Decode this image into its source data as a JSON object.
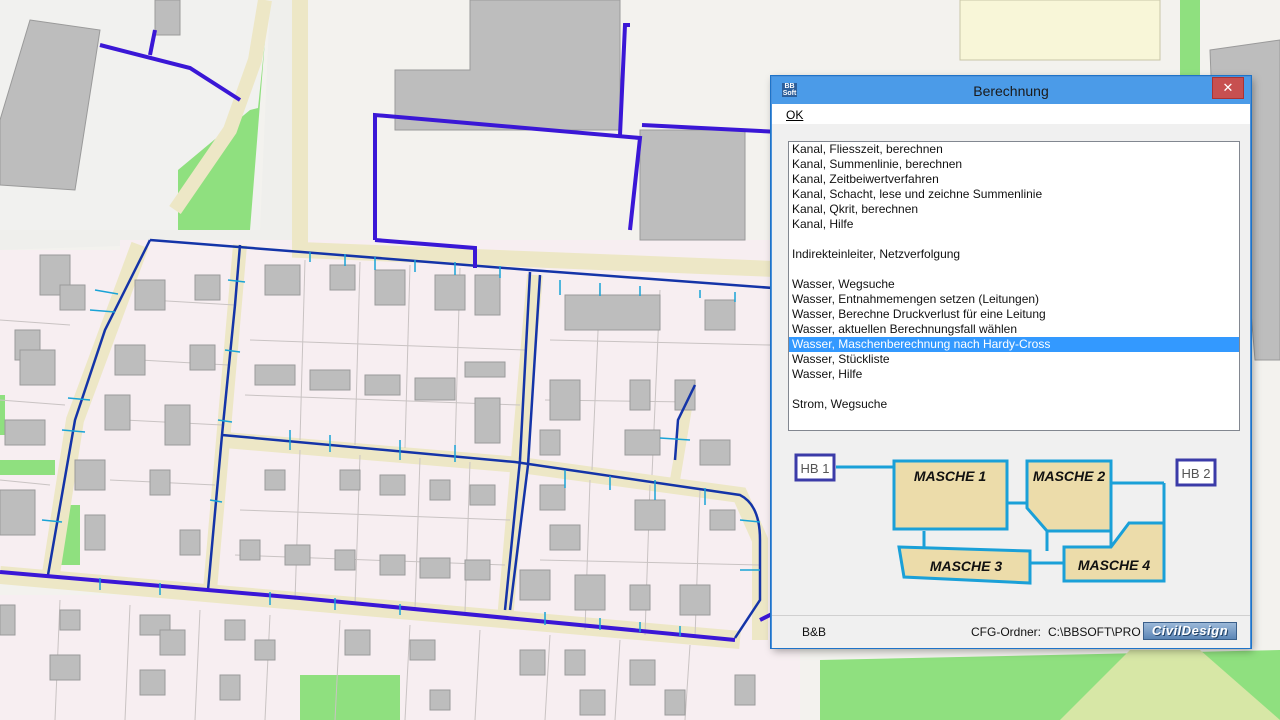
{
  "window": {
    "title": "Berechnung",
    "close_glyph": "✕",
    "app_icon_text": "BB Soft"
  },
  "menu": {
    "ok_label": "OK"
  },
  "list": {
    "items": [
      "Kanal, Fliesszeit, berechnen",
      "Kanal, Summenlinie, berechnen",
      "Kanal, Zeitbeiwertverfahren",
      "Kanal, Schacht, lese und zeichne Summenlinie",
      "Kanal, Qkrit, berechnen",
      "Kanal, Hilfe",
      "",
      "Indirekteinleiter, Netzverfolgung",
      "",
      "Wasser, Wegsuche",
      "Wasser, Entnahmemengen setzen (Leitungen)",
      "Wasser, Berechne Druckverlust für eine Leitung",
      "Wasser, aktuellen Berechnungsfall wählen",
      "Wasser, Maschenberechnung nach Hardy-Cross",
      "Wasser, Stückliste",
      "Wasser, Hilfe",
      "",
      "Strom, Wegsuche"
    ],
    "selected_index": 13
  },
  "diagram": {
    "hb1": "HB 1",
    "hb2": "HB 2",
    "masche1": "MASCHE 1",
    "masche2": "MASCHE 2",
    "masche3": "MASCHE 3",
    "masche4": "MASCHE 4"
  },
  "status": {
    "left": "B&B",
    "cfg_label": "CFG-Ordner:",
    "cfg_path": "C:\\BBSOFT\\PRO",
    "brand": "CivilDesign"
  },
  "colors": {
    "pipe_main": "#3a17d6",
    "pipe_secondary": "#1434a8",
    "house_connection": "#19a3d6",
    "building": "#bdbdbd",
    "green_area": "#8fe07f",
    "selection": "#3399ff",
    "diagram_line": "#1aa0d8",
    "diagram_fill": "#ecdcaa"
  }
}
